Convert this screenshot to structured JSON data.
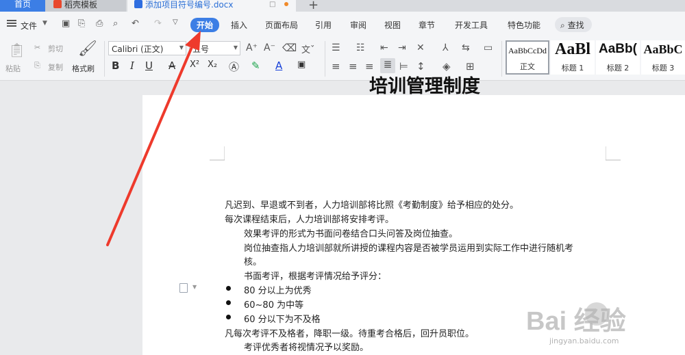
{
  "tabs": {
    "home": "首页",
    "template": "稻壳模板",
    "document": "添加项目符号编号.docx",
    "add": "+",
    "restore": "□"
  },
  "menu": {
    "file": "文件",
    "items": [
      "开始",
      "插入",
      "页面布局",
      "引用",
      "审阅",
      "视图",
      "章节",
      "开发工具",
      "特色功能"
    ],
    "active": "开始",
    "search": "查找"
  },
  "ribbon": {
    "paste": "粘贴",
    "cut": "剪切",
    "copy": "复制",
    "format_painter": "格式刷",
    "font_name": "Calibri (正文)",
    "font_size": "五号",
    "bold": "B",
    "italic": "I",
    "underline": "U",
    "strike": "A",
    "superscript": "X²",
    "subscript": "X₂",
    "styles": [
      {
        "sample": "AaBbCcDd",
        "name": "正文"
      },
      {
        "sample": "AaBl",
        "name": "标题 1"
      },
      {
        "sample": "AaBb(",
        "name": "标题 2"
      },
      {
        "sample": "AaBbC",
        "name": "标题 3"
      }
    ]
  },
  "document": {
    "title": "培训管理制度",
    "lines": [
      "凡迟到、早退或不到者，人力培训部将比照《考勤制度》给予相应的处分。",
      "每次课程结束后，人力培训部将安排考评。",
      "效果考评的形式为书面问卷结合口头问答及岗位抽查。",
      "岗位抽查指人力培训部就所讲授的课程内容是否被学员运用到实际工作中进行随机考",
      "核。",
      "书面考评，根据考评情况给予评分：",
      "80 分以上为优秀",
      "60~80 为中等",
      "60 分以下为不及格",
      "凡每次考评不及格者，降职一级。待重考合格后，回升员职位。",
      "考评优秀者将视情况予以奖励。"
    ]
  },
  "watermark": {
    "main": "Bai  经验",
    "sub": "jingyan.baidu.com"
  },
  "colors": {
    "accent": "#3c7ee5",
    "annotation": "#ee3a2c"
  }
}
